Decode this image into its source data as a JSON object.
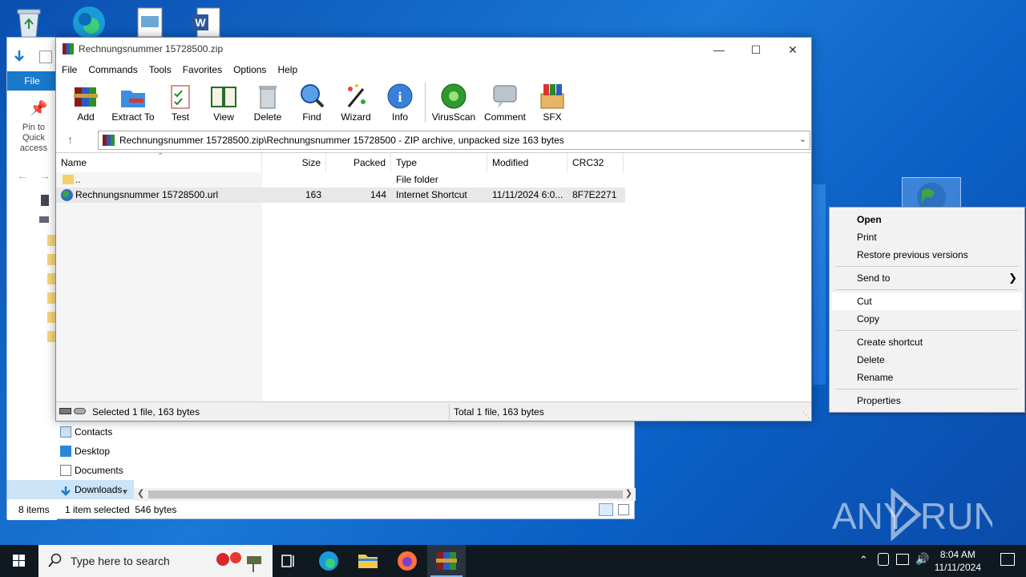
{
  "desktop": {
    "watermark": "ANY RUN"
  },
  "explorer": {
    "file_tab": "File",
    "pin_label": "Pin to Quick access",
    "nav_items": [
      "Contacts",
      "Desktop",
      "Documents",
      "Downloads"
    ],
    "status_items": "8 items",
    "status_selected": "1 item selected  546 bytes"
  },
  "rar": {
    "title": "Rechnungsnummer 15728500.zip",
    "menu": [
      "File",
      "Commands",
      "Tools",
      "Favorites",
      "Options",
      "Help"
    ],
    "toolbar": [
      {
        "label": "Add",
        "icon": "add-archive-icon"
      },
      {
        "label": "Extract To",
        "icon": "extract-folder-icon"
      },
      {
        "label": "Test",
        "icon": "test-clipboard-icon"
      },
      {
        "label": "View",
        "icon": "book-view-icon"
      },
      {
        "label": "Delete",
        "icon": "trash-bin-icon"
      },
      {
        "label": "Find",
        "icon": "magnifier-icon"
      },
      {
        "label": "Wizard",
        "icon": "magic-wand-icon"
      },
      {
        "label": "Info",
        "icon": "info-icon"
      },
      {
        "label": "VirusScan",
        "icon": "virus-scan-icon"
      },
      {
        "label": "Comment",
        "icon": "comment-icon"
      },
      {
        "label": "SFX",
        "icon": "sfx-box-icon"
      }
    ],
    "address": "Rechnungsnummer 15728500.zip\\Rechnungsnummer 15728500 - ZIP archive, unpacked size 163 bytes",
    "columns": [
      "Name",
      "Size",
      "Packed",
      "Type",
      "Modified",
      "CRC32"
    ],
    "rows": [
      {
        "name": "..",
        "size": "",
        "packed": "",
        "type": "File folder",
        "modified": "",
        "crc": ""
      },
      {
        "name": "Rechnungsnummer 15728500.url",
        "size": "163",
        "packed": "144",
        "type": "Internet Shortcut",
        "modified": "11/11/2024 6:0...",
        "crc": "8F7E2271"
      }
    ],
    "status_left": "Selected 1 file, 163 bytes",
    "status_right": "Total 1 file, 163 bytes"
  },
  "context_menu": {
    "items": [
      "Open",
      "Print",
      "Restore previous versions",
      "Send to",
      "Cut",
      "Copy",
      "Create shortcut",
      "Delete",
      "Rename",
      "Properties"
    ]
  },
  "taskbar": {
    "search_placeholder": "Type here to search",
    "time": "8:04 AM",
    "date": "11/11/2024"
  },
  "colors": {
    "accent": "#1979ca",
    "desktop": "#0b5fc4",
    "taskbar": "#101820"
  }
}
